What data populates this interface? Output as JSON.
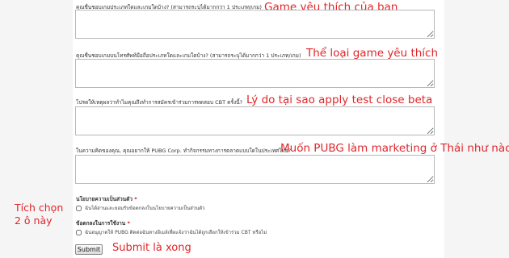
{
  "questions": [
    {
      "label": "คุณชื่นชอบเกมประเภทใดและเกมใดบ้าง? (สามารถระบุได้มากกว่า 1 ประเภท/เกม)",
      "annotation": "Game yêu thích của bạn"
    },
    {
      "label": "คุณชื่นชอบเกมบนโทรศัพท์มือถือประเภทใดและเกมใดบ้าง? (สามารถระบุได้มากกว่า 1 ประเภท/เกม)",
      "annotation": "Thể loại game yêu thích"
    },
    {
      "label": "โปรดให้เหตุผลว่าทำไมคุณถึงทำการสมัครเข้าร่วมการทดสอบ CBT ครั้งนี้?",
      "annotation": "Lý do tại sao apply test close beta"
    },
    {
      "label": "ในความคิดของคุณ, คุณอยากให้ PUBG Corp. ทำกิจกรรมทางการตลาดแบบใดในประเทศไทย?",
      "annotation": "Muốn PUBG làm marketing ở Thái như nào"
    }
  ],
  "privacy": {
    "title": "นโยบายความเป็นส่วนตัว",
    "required_mark": "*",
    "checkbox_label": "ฉันได้อ่านและยอมรับข้อตกลงในนโยบายความเป็นส่วนตัว"
  },
  "terms": {
    "title": "ข้อตกลงในการใช้งาน",
    "required_mark": "*",
    "checkbox_label": "ฉันอนุญาตให้ PUBG ติดต่อฉันทางอีเมล์เพื่อแจ้งว่าฉันได้ถูกเลือกให้เข้าร่วม CBT หรือไม่"
  },
  "side_note": {
    "line1": "Tích chọn",
    "line2": "2 ô này"
  },
  "submit": {
    "label": "Submit",
    "annotation": "Submit là xong"
  },
  "accent_color": "#e0262a"
}
